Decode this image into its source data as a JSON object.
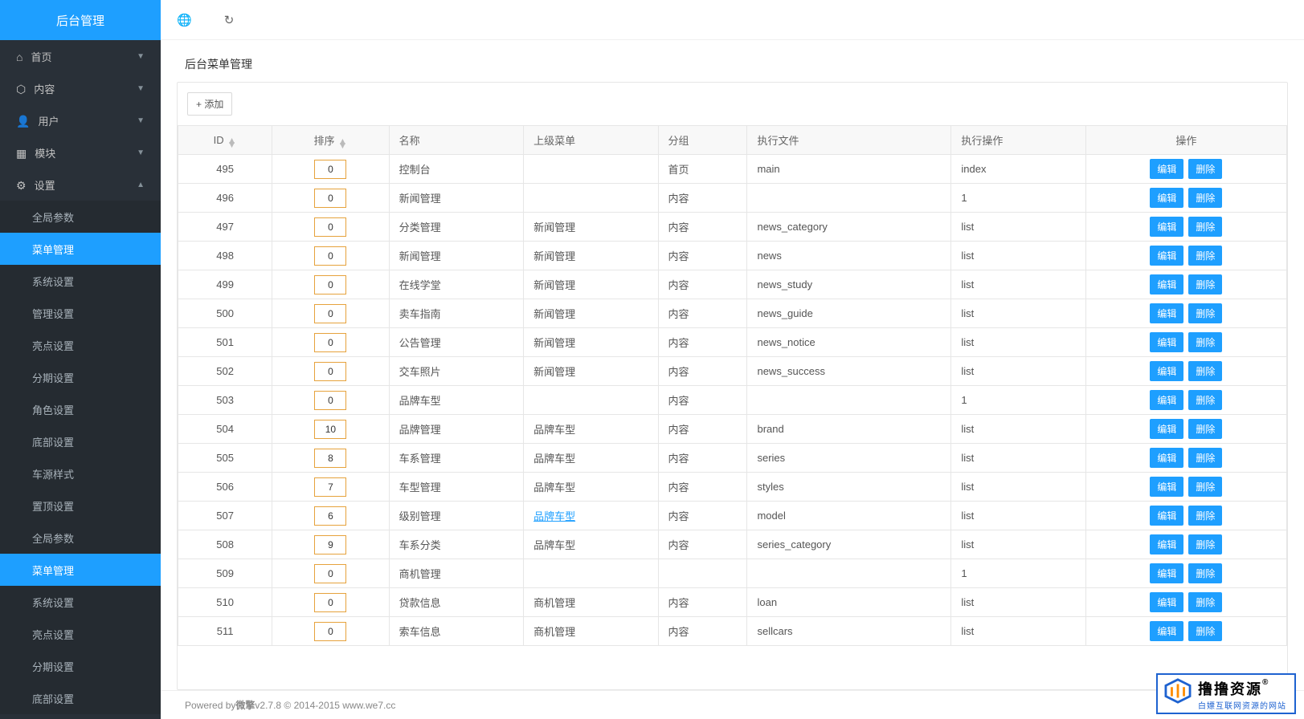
{
  "brand": "后台管理",
  "nav": {
    "groups": [
      {
        "icon": "⌂",
        "label": "首页",
        "expanded": false
      },
      {
        "icon": "⬡",
        "label": "内容",
        "expanded": false
      },
      {
        "icon": "👤",
        "label": "用户",
        "expanded": false
      },
      {
        "icon": "▦",
        "label": "模块",
        "expanded": false
      },
      {
        "icon": "⚙",
        "label": "设置",
        "expanded": true,
        "children": [
          "全局参数",
          "菜单管理",
          "系统设置",
          "管理设置",
          "亮点设置",
          "分期设置",
          "角色设置",
          "底部设置",
          "车源样式",
          "置顶设置",
          "全局参数",
          "菜单管理",
          "系统设置",
          "亮点设置",
          "分期设置",
          "底部设置"
        ],
        "active_child_index": [
          1,
          11
        ]
      }
    ]
  },
  "topbar": {
    "icons": [
      "globe",
      "refresh"
    ]
  },
  "crumb": "后台菜单管理",
  "add_button": "+ 添加",
  "columns": [
    "ID",
    "排序",
    "名称",
    "上级菜单",
    "分组",
    "执行文件",
    "执行操作",
    "操作"
  ],
  "action_labels": {
    "edit": "编辑",
    "delete": "删除"
  },
  "rows": [
    {
      "id": "495",
      "sort": "0",
      "name": "控制台",
      "parent": "",
      "group": "首页",
      "file": "main",
      "op": "index"
    },
    {
      "id": "496",
      "sort": "0",
      "name": "新闻管理",
      "parent": "",
      "group": "内容",
      "file": "",
      "op": "1"
    },
    {
      "id": "497",
      "sort": "0",
      "name": "分类管理",
      "parent": "新闻管理",
      "group": "内容",
      "file": "news_category",
      "op": "list"
    },
    {
      "id": "498",
      "sort": "0",
      "name": "新闻管理",
      "parent": "新闻管理",
      "group": "内容",
      "file": "news",
      "op": "list"
    },
    {
      "id": "499",
      "sort": "0",
      "name": "在线学堂",
      "parent": "新闻管理",
      "group": "内容",
      "file": "news_study",
      "op": "list"
    },
    {
      "id": "500",
      "sort": "0",
      "name": "卖车指南",
      "parent": "新闻管理",
      "group": "内容",
      "file": "news_guide",
      "op": "list"
    },
    {
      "id": "501",
      "sort": "0",
      "name": "公告管理",
      "parent": "新闻管理",
      "group": "内容",
      "file": "news_notice",
      "op": "list"
    },
    {
      "id": "502",
      "sort": "0",
      "name": "交车照片",
      "parent": "新闻管理",
      "group": "内容",
      "file": "news_success",
      "op": "list"
    },
    {
      "id": "503",
      "sort": "0",
      "name": "品牌车型",
      "parent": "",
      "group": "内容",
      "file": "",
      "op": "1"
    },
    {
      "id": "504",
      "sort": "10",
      "name": "品牌管理",
      "parent": "品牌车型",
      "group": "内容",
      "file": "brand",
      "op": "list"
    },
    {
      "id": "505",
      "sort": "8",
      "name": "车系管理",
      "parent": "品牌车型",
      "group": "内容",
      "file": "series",
      "op": "list"
    },
    {
      "id": "506",
      "sort": "7",
      "name": "车型管理",
      "parent": "品牌车型",
      "group": "内容",
      "file": "styles",
      "op": "list"
    },
    {
      "id": "507",
      "sort": "6",
      "name": "级别管理",
      "parent": "品牌车型",
      "parent_link": true,
      "group": "内容",
      "file": "model",
      "op": "list"
    },
    {
      "id": "508",
      "sort": "9",
      "name": "车系分类",
      "parent": "品牌车型",
      "group": "内容",
      "file": "series_category",
      "op": "list"
    },
    {
      "id": "509",
      "sort": "0",
      "name": "商机管理",
      "parent": "",
      "group": "",
      "file": "",
      "op": "1"
    },
    {
      "id": "510",
      "sort": "0",
      "name": "贷款信息",
      "parent": "商机管理",
      "group": "内容",
      "file": "loan",
      "op": "list"
    },
    {
      "id": "511",
      "sort": "0",
      "name": "索车信息",
      "parent": "商机管理",
      "group": "内容",
      "file": "sellcars",
      "op": "list"
    }
  ],
  "footer": {
    "prefix": "Powered by ",
    "product": "微擎",
    "version": " v2.7.8 © 2014-2015 www.we7.cc"
  },
  "watermark": {
    "t1": "撸撸资源",
    "reg": "®",
    "t2": "白嫖互联网资源的网站"
  }
}
